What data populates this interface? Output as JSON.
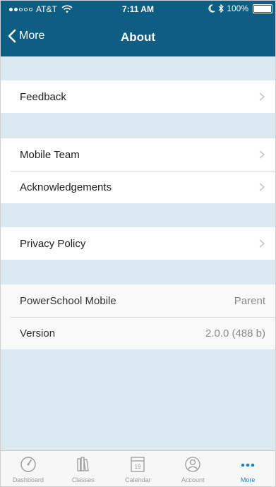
{
  "status_bar": {
    "carrier": "AT&T",
    "time": "7:11 AM",
    "battery": "100%"
  },
  "nav": {
    "back_label": "More",
    "title": "About"
  },
  "sections": [
    {
      "items": [
        {
          "label": "Feedback"
        }
      ]
    },
    {
      "items": [
        {
          "label": "Mobile Team"
        },
        {
          "label": "Acknowledgements"
        }
      ]
    },
    {
      "items": [
        {
          "label": "Privacy Policy"
        }
      ]
    }
  ],
  "info": [
    {
      "label": "PowerSchool Mobile",
      "value": "Parent"
    },
    {
      "label": "Version",
      "value": "2.0.0 (488 b)"
    }
  ],
  "tab_bar": {
    "tabs": [
      {
        "label": "Dashboard",
        "icon": "dashboard-icon"
      },
      {
        "label": "Classes",
        "icon": "classes-icon"
      },
      {
        "label": "Calendar",
        "icon": "calendar-icon",
        "date": "19"
      },
      {
        "label": "Account",
        "icon": "account-icon"
      },
      {
        "label": "More",
        "icon": "more-icon"
      }
    ],
    "active": "More"
  },
  "colors": {
    "header": "#0e5d82",
    "background": "#dbe9f1",
    "accent": "#1a86c6"
  }
}
